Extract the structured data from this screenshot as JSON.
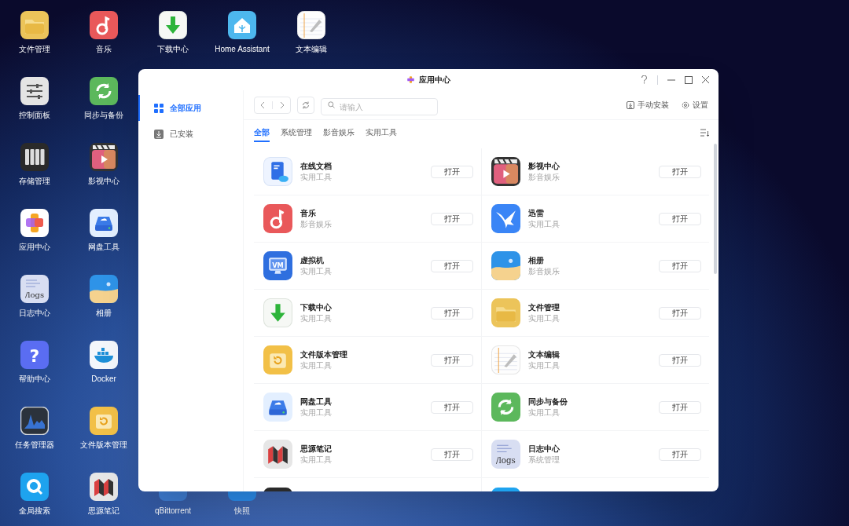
{
  "desktop": {
    "rows": [
      [
        {
          "label": "文件管理"
        },
        {
          "label": "音乐"
        },
        {
          "label": "下载中心"
        },
        {
          "label": "Home Assistant"
        },
        {
          "label": "文本编辑"
        }
      ],
      [
        {
          "label": "控制面板"
        },
        {
          "label": "同步与备份"
        }
      ],
      [
        {
          "label": "存储管理"
        },
        {
          "label": "影视中心"
        }
      ],
      [
        {
          "label": "应用中心"
        },
        {
          "label": "网盘工具"
        }
      ],
      [
        {
          "label": "日志中心",
          "icon_label": "/logs"
        },
        {
          "label": "相册"
        }
      ],
      [
        {
          "label": "帮助中心",
          "icon_label": "?"
        },
        {
          "label": "Docker"
        }
      ],
      [
        {
          "label": "任务管理器"
        },
        {
          "label": "文件版本管理"
        }
      ],
      [
        {
          "label": "全局搜索"
        },
        {
          "label": "思源笔记"
        },
        {
          "label": "qBittorrent"
        },
        {
          "label": "快照"
        }
      ]
    ]
  },
  "window": {
    "title": "应用中心",
    "sidebar": [
      {
        "label": "全部应用",
        "selected": true
      },
      {
        "label": "已安装",
        "selected": false
      }
    ],
    "search": {
      "placeholder": "请输入"
    },
    "actions": [
      {
        "label": "手动安装"
      },
      {
        "label": "设置"
      }
    ],
    "tabs": [
      {
        "label": "全部",
        "selected": true
      },
      {
        "label": "系统管理",
        "selected": false
      },
      {
        "label": "影音娱乐",
        "selected": false
      },
      {
        "label": "实用工具",
        "selected": false
      }
    ],
    "apps": [
      {
        "name": "在线文档",
        "category": "实用工具",
        "button": "打开"
      },
      {
        "name": "影视中心",
        "category": "影音娱乐",
        "button": "打开"
      },
      {
        "name": "音乐",
        "category": "影音娱乐",
        "button": "打开"
      },
      {
        "name": "迅雷",
        "category": "实用工具",
        "button": "打开"
      },
      {
        "name": "虚拟机",
        "category": "实用工具",
        "button": "打开",
        "icon_label": "VM"
      },
      {
        "name": "相册",
        "category": "影音娱乐",
        "button": "打开"
      },
      {
        "name": "下载中心",
        "category": "实用工具",
        "button": "打开"
      },
      {
        "name": "文件管理",
        "category": "实用工具",
        "button": "打开"
      },
      {
        "name": "文件版本管理",
        "category": "实用工具",
        "button": "打开"
      },
      {
        "name": "文本编辑",
        "category": "实用工具",
        "button": "打开"
      },
      {
        "name": "网盘工具",
        "category": "实用工具",
        "button": "打开"
      },
      {
        "name": "同步与备份",
        "category": "实用工具",
        "button": "打开"
      },
      {
        "name": "思源笔记",
        "category": "实用工具",
        "button": "打开"
      },
      {
        "name": "日志中心",
        "category": "系统管理",
        "button": "打开",
        "icon_label": "/logs"
      }
    ]
  }
}
